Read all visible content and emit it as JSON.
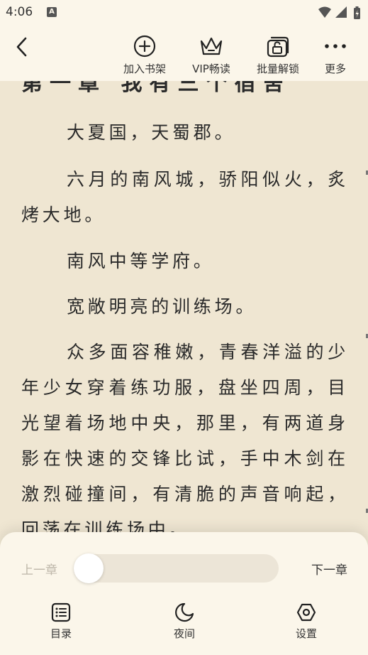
{
  "status": {
    "time": "4:06",
    "notification": "A"
  },
  "toolbar": {
    "add_shelf": "加入书架",
    "vip_read": "VIP畅读",
    "batch_unlock": "批量解锁",
    "more": "更多"
  },
  "chapter": {
    "title": "第一章 我有三个宿舍",
    "paragraphs": [
      "大夏国，天蜀郡。",
      "六月的南风城，骄阳似火，炙烤大地。",
      "南风中等学府。",
      "宽敞明亮的训练场。",
      "众多面容稚嫩，青春洋溢的少年少女穿着练功服，盘坐四周，目光望着场地中央，那里，有两道身影在快速的交锋比试，手中木剑在激烈碰撞间，有清脆的声音响起，回荡在训练场中。"
    ]
  },
  "bottom": {
    "prev_chapter": "上一章",
    "next_chapter": "下一章",
    "progress": 0.0,
    "catalog": "目录",
    "night": "夜间",
    "settings": "设置"
  },
  "colors": {
    "page_bg": "#efe6d2",
    "panel_bg": "#fbf6ea",
    "text": "#2a2a2a",
    "disabled": "#bdb6a9"
  }
}
